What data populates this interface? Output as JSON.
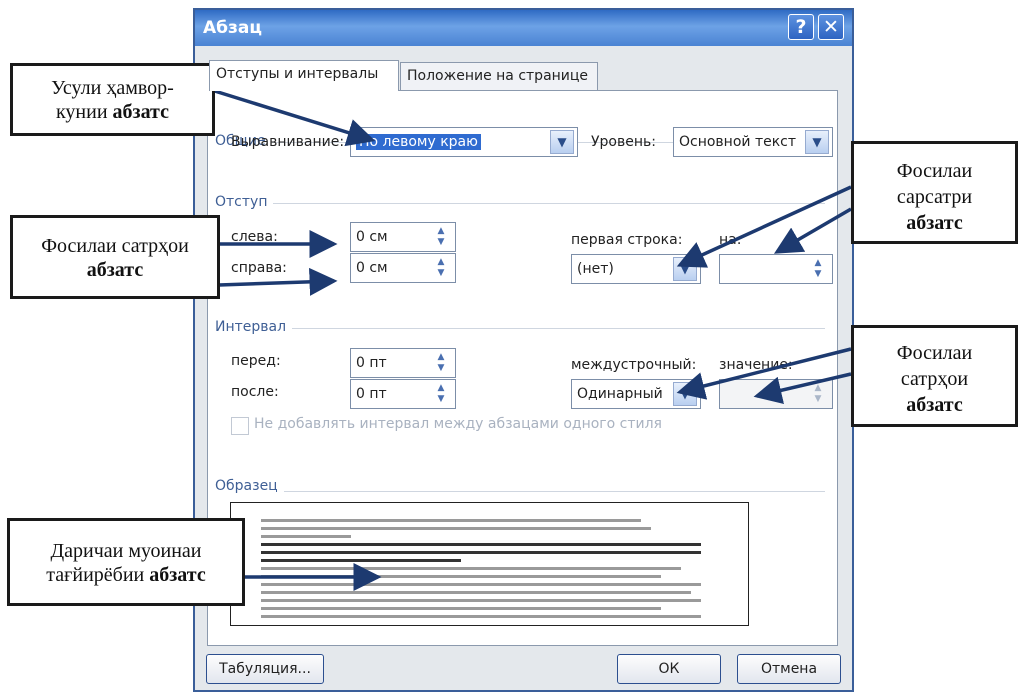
{
  "dialog": {
    "title": "Абзац",
    "help_button": "?",
    "close_button": "✕",
    "tabs": [
      {
        "label": "Отступы и интервалы",
        "active": true
      },
      {
        "label": "Положение на странице",
        "active": false
      }
    ],
    "general": {
      "section": "Общие",
      "alignment_label": "Выравнивание:",
      "alignment_value": "По левому краю",
      "level_label": "Уровень:",
      "level_value": "Основной текст"
    },
    "indent": {
      "section": "Отступ",
      "left_label": "слева:",
      "left_value": "0 см",
      "right_label": "справа:",
      "right_value": "0 см",
      "first_line_label": "первая строка:",
      "first_line_value": "(нет)",
      "by_label": "на:",
      "by_value": ""
    },
    "spacing": {
      "section": "Интервал",
      "before_label": "перед:",
      "before_value": "0 пт",
      "after_label": "после:",
      "after_value": "0 пт",
      "line_label": "междустрочный:",
      "line_value": "Одинарный",
      "at_label": "значение:",
      "at_value": "",
      "no_space_checkbox": "Не добавлять интервал между абзацами одного стиля"
    },
    "preview": {
      "section": "Образец"
    },
    "buttons": {
      "tabs": "Табуляция...",
      "ok": "ОК",
      "cancel": "Отмена"
    }
  },
  "callouts": {
    "c1": {
      "line1": "Усули ҳамвор-",
      "line2_text": "кунии ",
      "line2_bold": "абзатс"
    },
    "c2": {
      "line1": "Фосилаи сатрҳои",
      "line2_bold": "абзатс"
    },
    "c3": {
      "line1": "Фосилаи",
      "line2": "сарсатри",
      "line3_bold": "абзатс"
    },
    "c4": {
      "line1": "Фосилаи",
      "line2": "сатрҳои",
      "line3_bold": "абзатс"
    },
    "c5": {
      "line1": "Даричаи муоинаи",
      "line2_text": "тағйирёбии ",
      "line2_bold": "абзатс"
    }
  }
}
